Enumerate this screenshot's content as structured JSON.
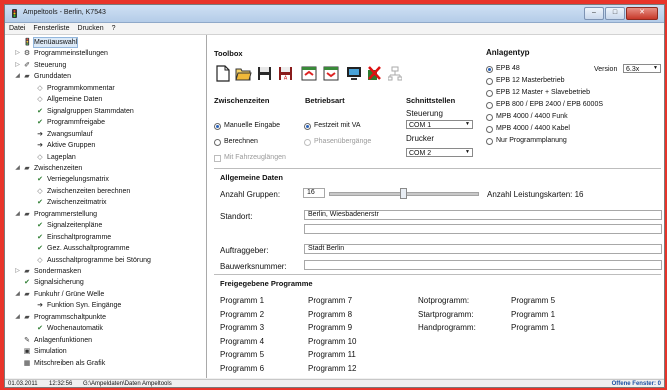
{
  "window": {
    "title": "Ampeltools - Berlin, K7543",
    "min": "–",
    "max": "□",
    "close": "✕"
  },
  "menu": [
    "Datei",
    "Fensterliste",
    "Drucken",
    "?"
  ],
  "tree": [
    {
      "label": "Menüauswahl",
      "icon": "traffic-light-icon"
    },
    {
      "label": "Programmeinstellungen",
      "icon": "settings-icon"
    },
    {
      "label": "Steuerung",
      "icon": "steering-icon"
    },
    {
      "label": "Grunddaten",
      "icon": "folder-icon"
    },
    {
      "label": "Programmkommentar",
      "icon": "bullet-icon"
    },
    {
      "label": "Allgemeine Daten",
      "icon": "bullet-icon"
    },
    {
      "label": "Signalgruppen Stammdaten",
      "icon": "check-icon"
    },
    {
      "label": "Programmfreigabe",
      "icon": "check-icon"
    },
    {
      "label": "Zwangsumlauf",
      "icon": "arrow-icon"
    },
    {
      "label": "Aktive Gruppen",
      "icon": "arrow-icon"
    },
    {
      "label": "Lageplan",
      "icon": "bullet-icon"
    },
    {
      "label": "Zwischenzeiten",
      "icon": "folder-icon"
    },
    {
      "label": "Verriegelungsmatrix",
      "icon": "check-icon"
    },
    {
      "label": "Zwischenzeiten berechnen",
      "icon": "bullet-icon"
    },
    {
      "label": "Zwischenzeitmatrix",
      "icon": "check-icon"
    },
    {
      "label": "Programmerstellung",
      "icon": "folder-icon"
    },
    {
      "label": "Signalzeitenpläne",
      "icon": "check-icon"
    },
    {
      "label": "Einschaltprogramme",
      "icon": "check-icon"
    },
    {
      "label": "Gez. Ausschaltprogramme",
      "icon": "check-icon"
    },
    {
      "label": "Ausschaltprogramme bei Störung",
      "icon": "bullet-icon"
    },
    {
      "label": "Sondermasken",
      "icon": "folder-icon"
    },
    {
      "label": "Signalsicherung",
      "icon": "check-icon"
    },
    {
      "label": "Funkuhr / Grüne Welle",
      "icon": "folder-icon"
    },
    {
      "label": "Funktion Syn. Eingänge",
      "icon": "arrow-icon"
    },
    {
      "label": "Programmschaltpunkte",
      "icon": "folder-icon"
    },
    {
      "label": "Wochenautomatik",
      "icon": "check-icon"
    },
    {
      "label": "Anlagenfunktionen",
      "icon": "tool-icon"
    },
    {
      "label": "Simulation",
      "icon": "simulation-icon"
    },
    {
      "label": "Mitschreiben als Grafik",
      "icon": "chart-icon"
    }
  ],
  "toolbox": {
    "title": "Toolbox"
  },
  "zwischenzeiten": {
    "title": "Zwischenzeiten",
    "opt1": "Manuelle Eingabe",
    "opt2": "Berechnen",
    "chk": "Mit Fahrzeuglängen"
  },
  "betriebsart": {
    "title": "Betriebsart",
    "opt1": "Festzeit mit VA",
    "opt2": "Phasenübergänge"
  },
  "schnittstellen": {
    "title": "Schnittstellen",
    "steuerung_label": "Steuerung",
    "steuerung_value": "COM 1",
    "drucker_label": "Drucker",
    "drucker_value": "COM 2"
  },
  "anlagentyp": {
    "title": "Anlagentyp",
    "options": [
      "EPB 48",
      "EPB 12 Masterbetrieb",
      "EPB 12 Master + Slavebetrieb",
      "EPB 800 / EPB 2400 / EPB 6000S",
      "MPB 4000 / 4400 Funk",
      "MPB 4000 / 4400 Kabel",
      "Nur Programmplanung"
    ],
    "version_label": "Version",
    "version_value": "6.3x"
  },
  "allgemeine": {
    "title": "Allgemeine Daten",
    "anzahl_label": "Anzahl Gruppen:",
    "anzahl_value": "16",
    "leistungskarten": "Anzahl Leistungskarten: 16",
    "slider_fraction": 0.5,
    "standort_label": "Standort:",
    "standort_value": "Berlin, Wiesbadenerstr",
    "auftraggeber_label": "Auftraggeber:",
    "auftraggeber_value": "Stadt Berlin",
    "bauwerksnummer_label": "Bauwerksnummer:"
  },
  "freigegebene": {
    "title": "Freigegebene Programme",
    "col1": [
      "Programm 1",
      "Programm 2",
      "Programm 3",
      "Programm 4",
      "Programm 5",
      "Programm 6"
    ],
    "col2": [
      "Programm 7",
      "Programm 8",
      "Programm 9",
      "Programm 10",
      "Programm 11",
      "Programm 12"
    ],
    "labels": [
      "Notprogramm:",
      "Startprogramm:",
      "Handprogramm:"
    ],
    "values": [
      "Programm 5",
      "Programm 1",
      "Programm 1"
    ]
  },
  "status": {
    "date": "01.03.2011",
    "time": "12:32:56",
    "path": "G:\\Ampeldaten\\Daten Ampeltools",
    "right": "Offene Fenster: 0"
  }
}
